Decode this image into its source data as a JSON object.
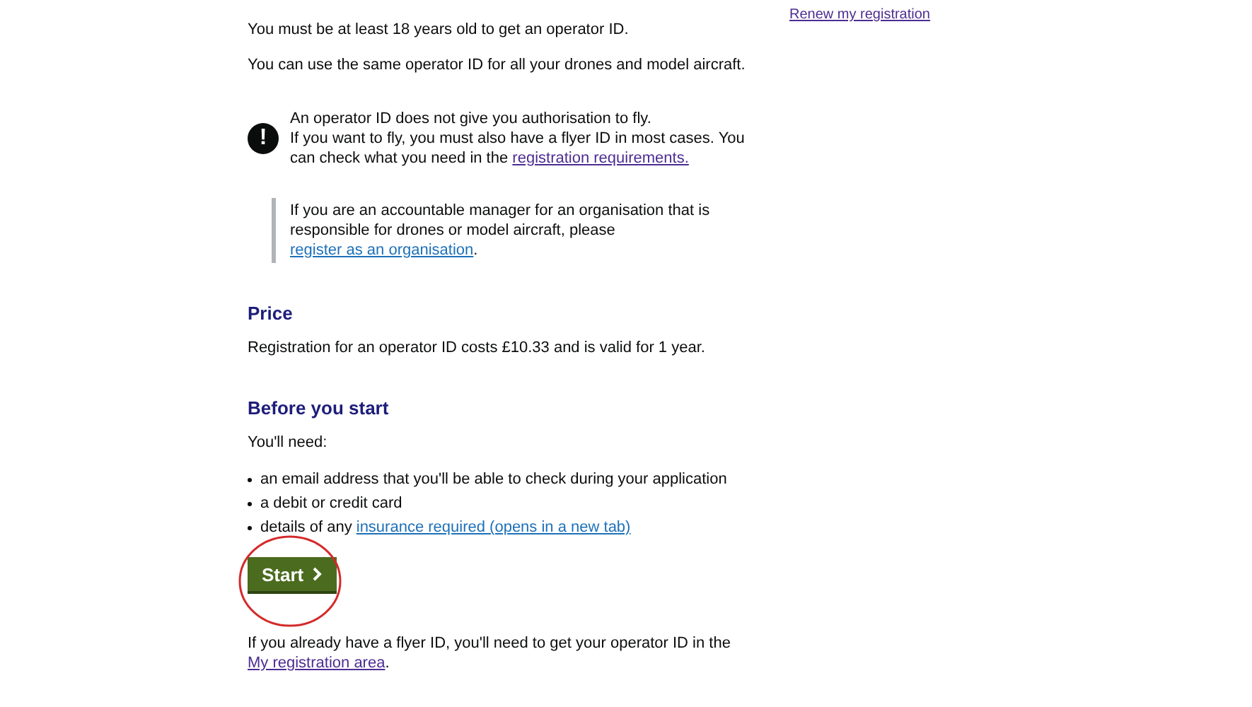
{
  "main": [
    {
      "kind": "paragraph",
      "parts": [
        {
          "text": "You must be at least 18 years old to get an operator ID."
        }
      ]
    },
    {
      "kind": "paragraph",
      "parts": [
        {
          "text": "You can use the same operator ID for all your drones and model aircraft."
        }
      ]
    },
    {
      "kind": "warning",
      "icon": "!",
      "lines": [
        [
          {
            "text": "An operator ID does not give you authorisation to fly."
          }
        ],
        [
          {
            "text": "If you want to fly, you must also have a flyer ID in most cases. You can check what you need in the "
          },
          {
            "link": "registration requirements.",
            "visited": true
          }
        ]
      ]
    },
    {
      "kind": "inset",
      "parts": [
        {
          "text": "If you are an accountable manager for an organisation that is responsible for drones or model aircraft, please "
        },
        {
          "link": "register as an organisation",
          "visited": false
        },
        {
          "text": "."
        }
      ]
    },
    {
      "kind": "heading",
      "text": "Price"
    },
    {
      "kind": "paragraph",
      "parts": [
        {
          "text": "Registration for an operator ID costs £10.33 and is valid for 1 year."
        }
      ]
    },
    {
      "kind": "heading",
      "text": "Before you start"
    },
    {
      "kind": "paragraph",
      "parts": [
        {
          "text": "You'll need:"
        }
      ]
    },
    {
      "kind": "list",
      "items": [
        [
          {
            "text": "an email address that you'll be able to check during your application"
          }
        ],
        [
          {
            "text": "a debit or credit card"
          }
        ],
        [
          {
            "text": "details of any "
          },
          {
            "link": "insurance required (opens in a new tab)",
            "visited": false
          }
        ]
      ]
    },
    {
      "kind": "button",
      "label": "Start",
      "circled": true
    },
    {
      "kind": "paragraph",
      "parts": [
        {
          "text": "If you already have a flyer ID, you'll need to get your operator ID in the "
        },
        {
          "link": "My registration area",
          "visited": true
        },
        {
          "text": "."
        }
      ]
    }
  ],
  "sidebar": {
    "links": [
      {
        "link": "Renew my registration",
        "visited": true
      }
    ]
  }
}
